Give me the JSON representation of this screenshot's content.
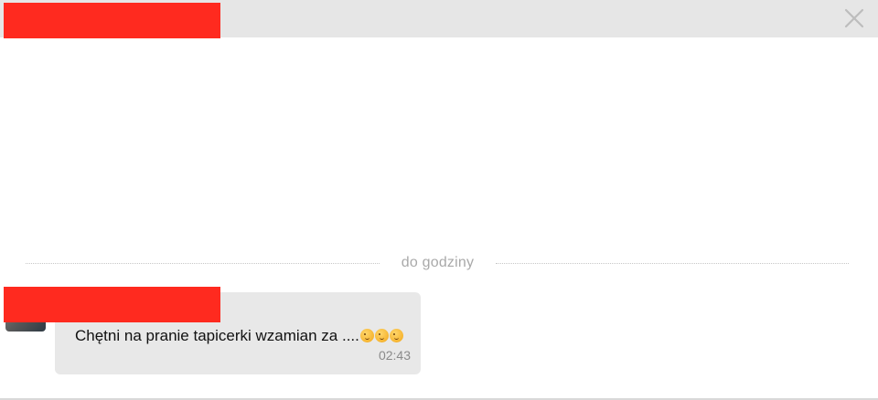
{
  "header": {
    "close_icon": "close-icon"
  },
  "divider": {
    "label": "do godziny"
  },
  "message": {
    "text": "Chętni na pranie tapicerki wzamian za ....",
    "emojis": [
      "winking-face-emoji",
      "winking-face-emoji",
      "winking-face-emoji"
    ],
    "time": "02:43"
  },
  "colors": {
    "header_bg": "#e6e6e6",
    "redaction": "#ff2a1f",
    "bubble_bg": "#e8e8e8",
    "muted_text": "#a9a9a9"
  }
}
